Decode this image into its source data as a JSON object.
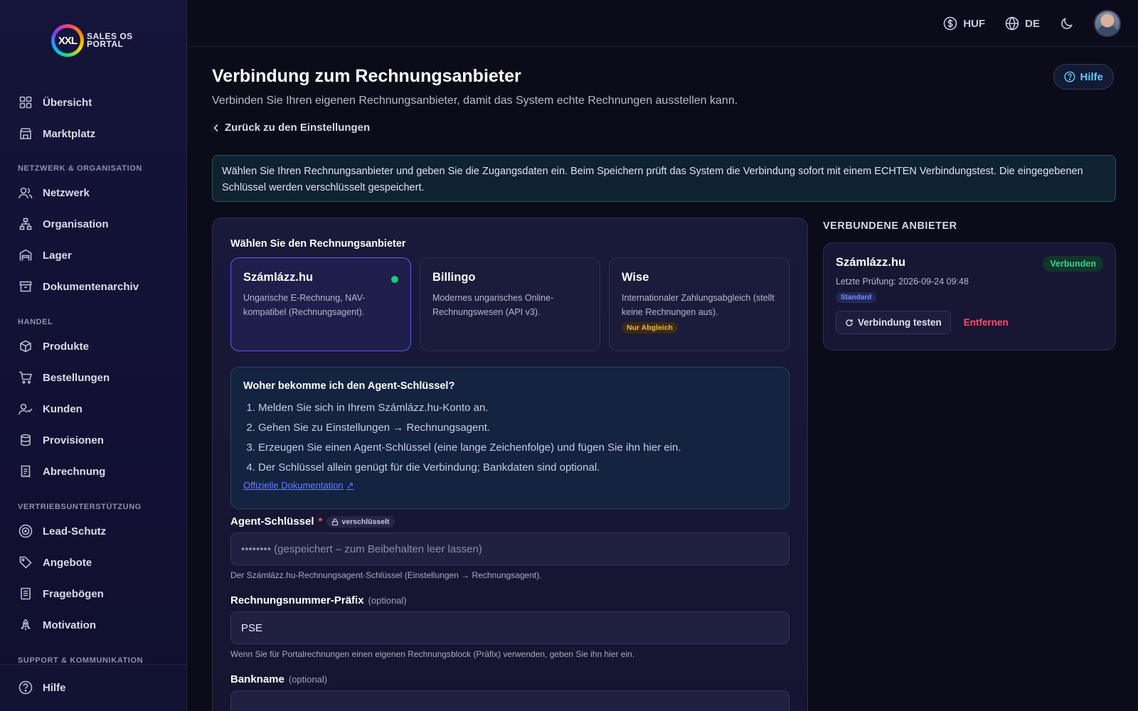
{
  "logo": {
    "badge": "XXL",
    "line1": "SALES OS",
    "line2": "PORTAL"
  },
  "sidebar": {
    "items": [
      {
        "label": "Übersicht",
        "icon": "grid-icon"
      },
      {
        "label": "Marktplatz",
        "icon": "store-icon"
      }
    ],
    "section1": "NETZWERK & ORGANISATION",
    "items_net": [
      {
        "label": "Netzwerk",
        "icon": "users-icon"
      },
      {
        "label": "Organisation",
        "icon": "org-chart-icon"
      },
      {
        "label": "Lager",
        "icon": "warehouse-icon"
      },
      {
        "label": "Dokumentenarchiv",
        "icon": "archive-icon"
      }
    ],
    "section2": "HANDEL",
    "items_trade": [
      {
        "label": "Produkte",
        "icon": "box-icon"
      },
      {
        "label": "Bestellungen",
        "icon": "cart-icon"
      },
      {
        "label": "Kunden",
        "icon": "user-check-icon"
      },
      {
        "label": "Provisionen",
        "icon": "database-icon"
      },
      {
        "label": "Abrechnung",
        "icon": "receipt-icon"
      }
    ],
    "section3": "VERTRIEBSUNTERSTÜTZUNG",
    "items_sales": [
      {
        "label": "Lead-Schutz",
        "icon": "target-icon"
      },
      {
        "label": "Angebote",
        "icon": "tag-icon"
      },
      {
        "label": "Fragebögen",
        "icon": "clipboard-icon"
      },
      {
        "label": "Motivation",
        "icon": "rocket-icon"
      }
    ],
    "section4": "SUPPORT & KOMMUNIKATION",
    "help": "Hilfe"
  },
  "topbar": {
    "currency": "HUF",
    "language": "DE"
  },
  "page": {
    "title": "Verbindung zum Rechnungsanbieter",
    "subtitle": "Verbinden Sie Ihren eigenen Rechnungsanbieter, damit das System echte Rechnungen ausstellen kann.",
    "back": "Zurück zu den Einstellungen",
    "help": "Hilfe",
    "info": "Wählen Sie Ihren Rechnungsanbieter und geben Sie die Zugangsdaten ein. Beim Speichern prüft das System die Verbindung sofort mit einem ECHTEN Verbindungstest. Die eingegebenen Schlüssel werden verschlüsselt gespeichert."
  },
  "providers": {
    "label": "Wählen Sie den Rechnungsanbieter",
    "list": [
      {
        "name": "Számlázz.hu",
        "desc": "Ungarische E-Rechnung, NAV-kompatibel (Rechnungsagent).",
        "selected": true
      },
      {
        "name": "Billingo",
        "desc": "Modernes ungarisches Online-Rechnungswesen (API v3)."
      },
      {
        "name": "Wise",
        "desc": "Internationaler Zahlungsabgleich (stellt keine Rechnungen aus).",
        "tag": "Nur Abgleich"
      }
    ]
  },
  "howto": {
    "title": "Woher bekomme ich den Agent-Schlüssel?",
    "steps": [
      "Melden Sie sich in Ihrem Számlázz.hu-Konto an.",
      "Gehen Sie zu Einstellungen → Rechnungsagent.",
      "Erzeugen Sie einen Agent-Schlüssel (eine lange Zeichenfolge) und fügen Sie ihn hier ein.",
      "Der Schlüssel allein genügt für die Verbindung; Bankdaten sind optional."
    ],
    "link": "Offizielle Dokumentation"
  },
  "form": {
    "agent_label": "Agent-Schlüssel",
    "required": "*",
    "encrypted": "verschlüsselt",
    "agent_placeholder": "•••••••• (gespeichert – zum Beibehalten leer lassen)",
    "agent_hint": "Der Számlázz.hu-Rechnungsagent-Schlüssel (Einstellungen → Rechnungsagent).",
    "prefix_label": "Rechnungsnummer-Präfix",
    "optional": "(optional)",
    "prefix_value": "PSE",
    "prefix_hint": "Wenn Sie für Portalrechnungen einen eigenen Rechnungsblock (Präfix) verwenden, geben Sie ihn hier ein.",
    "bank_label": "Bankname"
  },
  "connected": {
    "title": "VERBUNDENE ANBIETER",
    "name": "Számlázz.hu",
    "status": "Verbunden",
    "last_check": "Letzte Prüfung: 2026-09-24 09:48",
    "tag": "Standard",
    "test": "Verbindung testen",
    "remove": "Entfernen"
  }
}
